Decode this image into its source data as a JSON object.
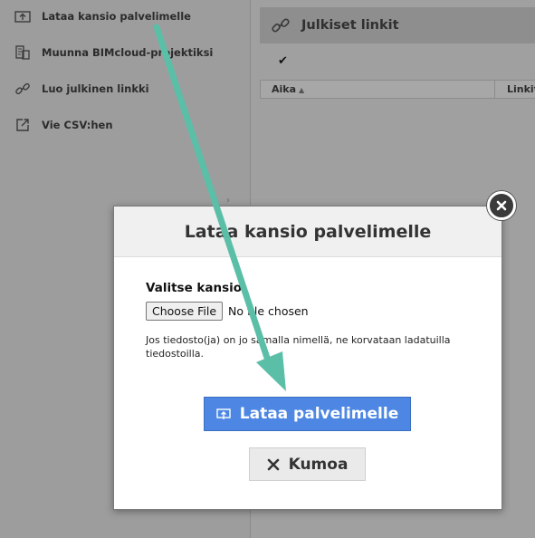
{
  "sidebar": {
    "items": [
      {
        "label": "Lataa kansio palvelimelle",
        "icon": "upload-folder-icon"
      },
      {
        "label": "Muunna BIMcloud-projektiksi",
        "icon": "convert-project-icon"
      },
      {
        "label": "Luo julkinen linkki",
        "icon": "link-icon"
      },
      {
        "label": "Vie CSV:hen",
        "icon": "export-icon"
      }
    ]
  },
  "public_links_panel": {
    "title": "Julkiset linkit",
    "icon": "link-icon",
    "checkmark": "✔",
    "columns": [
      "Aika",
      "Linkit"
    ],
    "sort_indicator": "▲"
  },
  "modal": {
    "title": "Lataa kansio palvelimelle",
    "close_icon": "close-icon",
    "field_label": "Valitse kansio",
    "file_button": "Choose File",
    "file_status": "No file chosen",
    "note": "Jos tiedosto(ja) on jo samalla nimellä, ne korvataan ladatuilla tiedostoilla.",
    "primary_button": "Lataa palvelimelle",
    "primary_icon": "upload-icon",
    "cancel_button": "Kumoa",
    "cancel_icon": "x-icon"
  },
  "colors": {
    "overlay_gray": "#9c9c9c",
    "primary_blue": "#4d87e3",
    "arrow_teal": "#5bbfa8"
  }
}
